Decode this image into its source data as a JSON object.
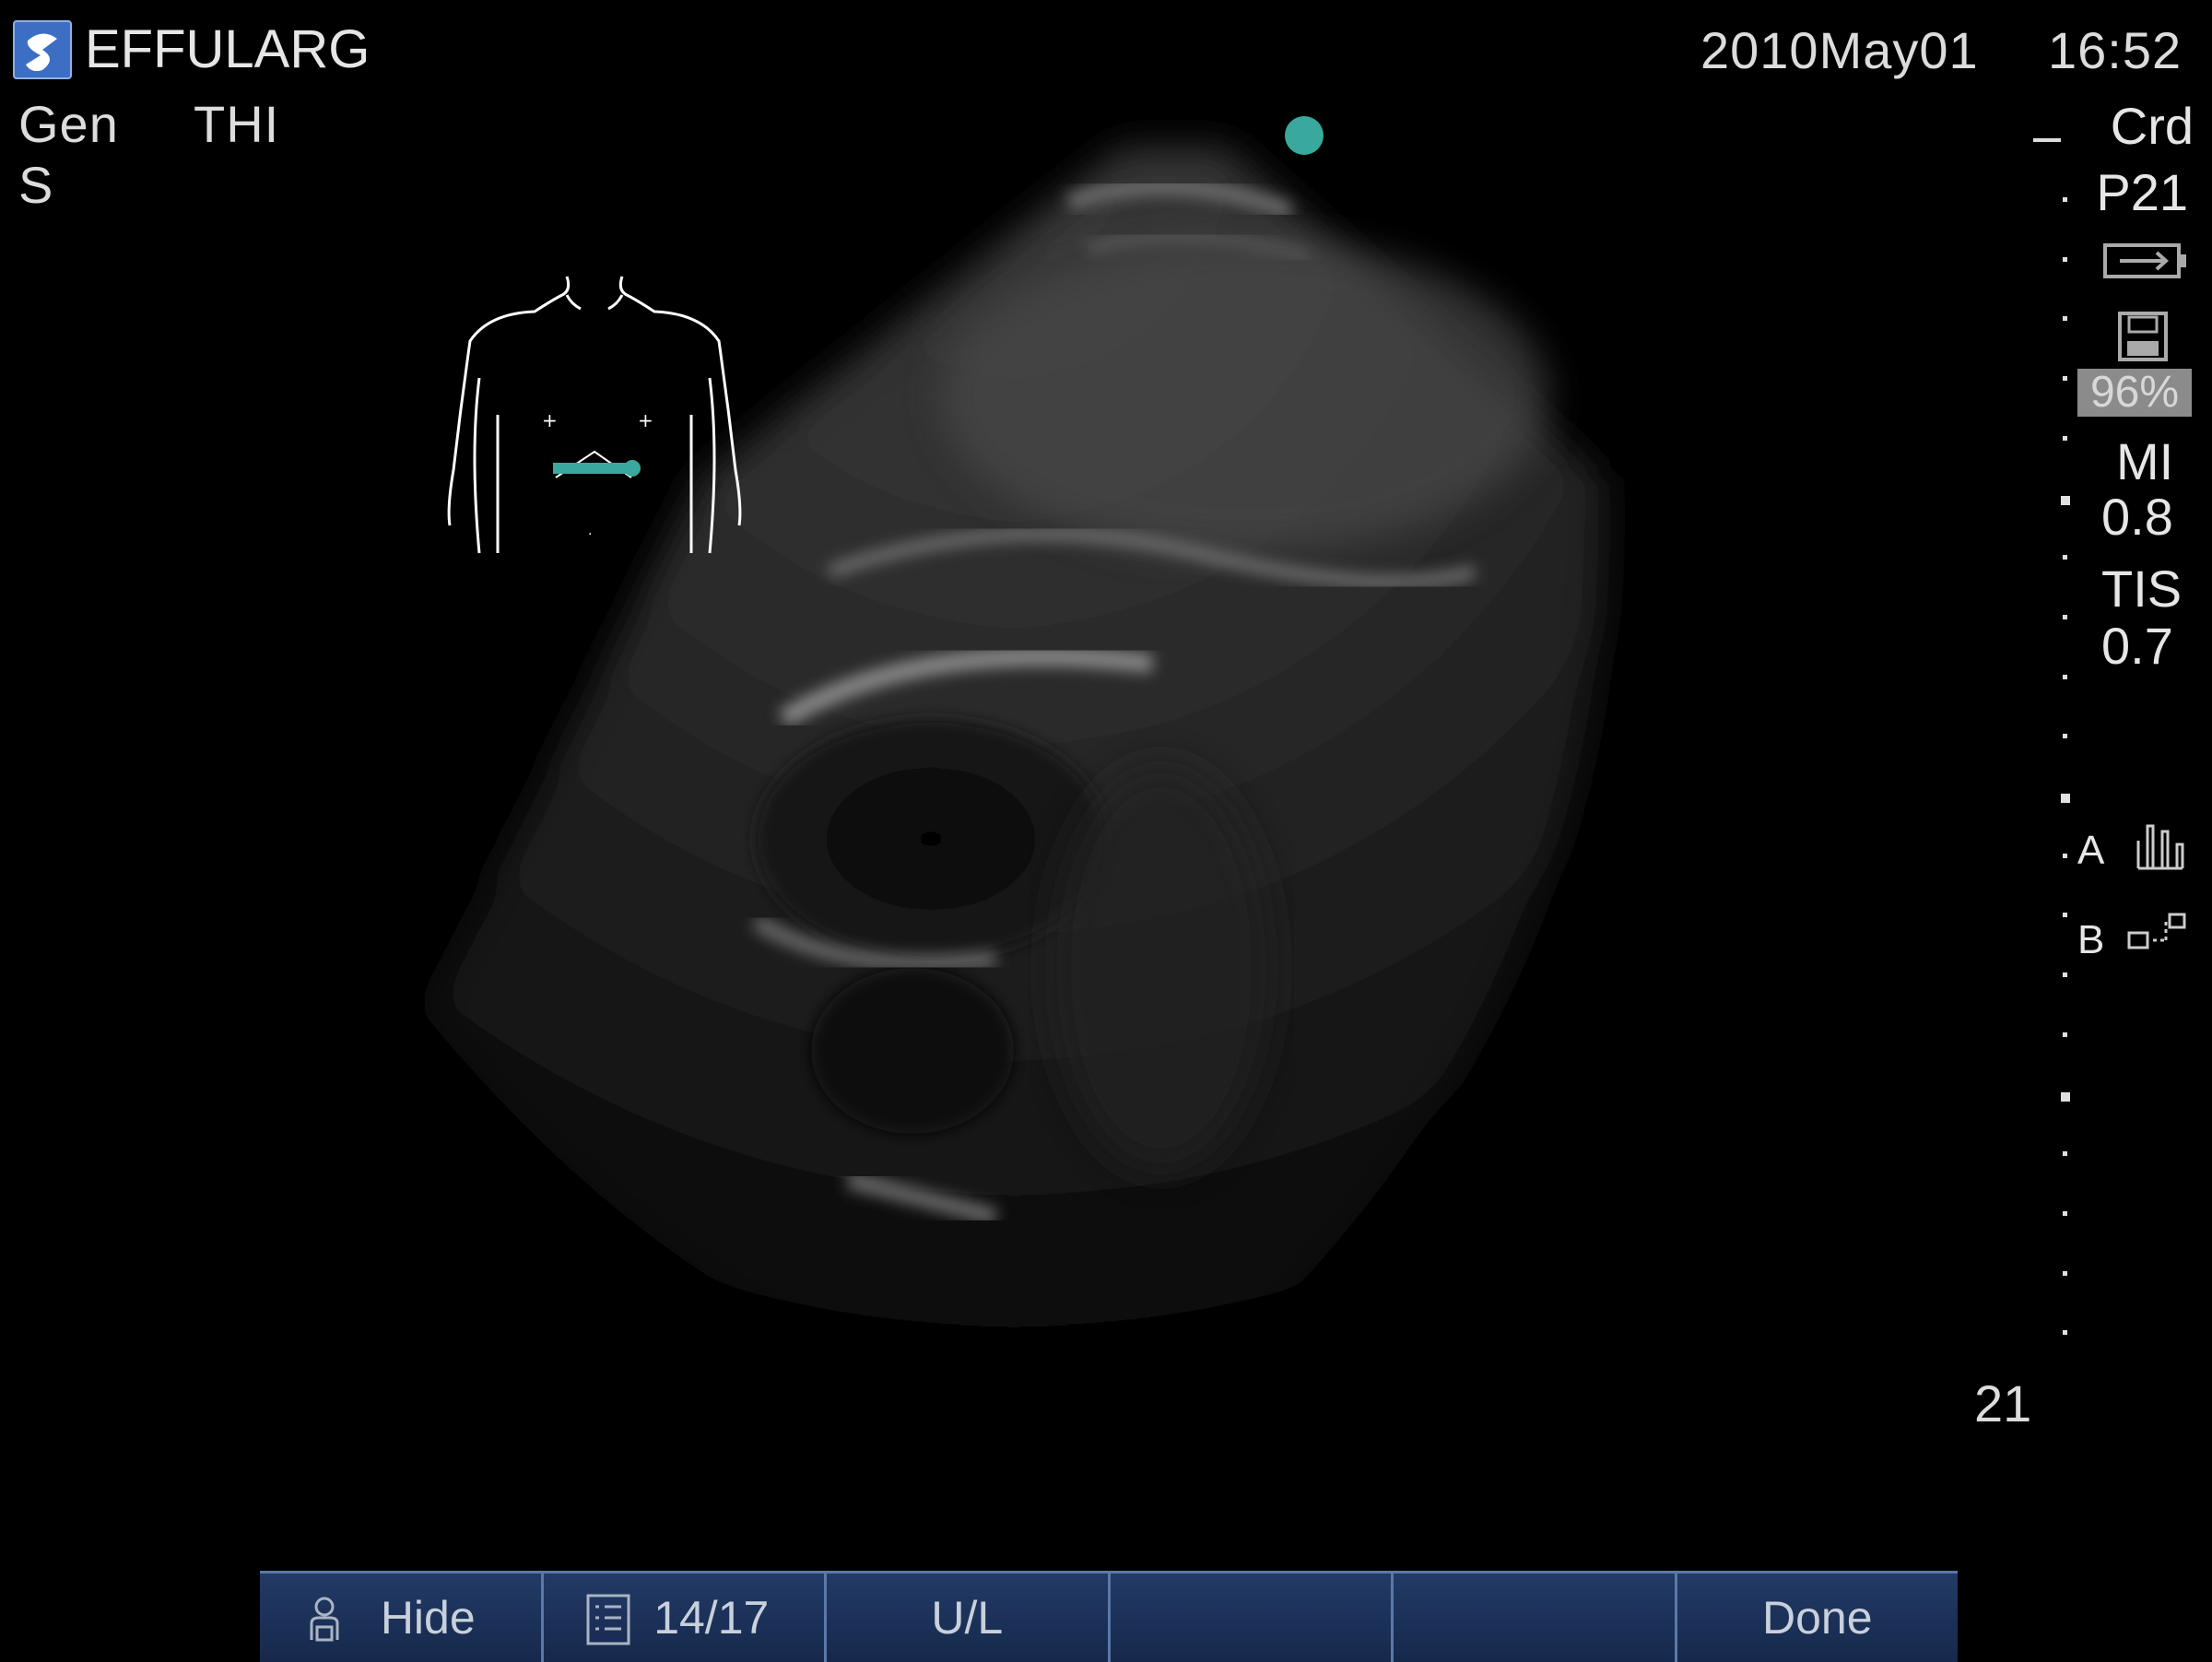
{
  "header": {
    "title": "EFFULARG",
    "date": "2010May01",
    "time": "16:52",
    "mode_gen": "Gen",
    "mode_thi": "THI",
    "mode_s": "S"
  },
  "right_panel": {
    "preset": "Crd",
    "probe": "P21",
    "storage_percent": "96%",
    "mi_label": "MI",
    "mi_value": "0.8",
    "tis_label": "TIS",
    "tis_value": "0.7",
    "focus_a": "A",
    "focus_b": "B"
  },
  "depth_label": "21",
  "softkeys": [
    {
      "label": "Hide",
      "icon": "patient-icon"
    },
    {
      "label": "14/17",
      "icon": "list-icon"
    },
    {
      "label": "U/L",
      "icon": ""
    },
    {
      "label": "",
      "icon": ""
    },
    {
      "label": "",
      "icon": ""
    },
    {
      "label": "Done",
      "icon": ""
    }
  ],
  "colors": {
    "marker_teal": "#3aa99d",
    "softkey_bar": "#1b3158",
    "background": "#000000"
  },
  "icons": [
    "logo-icon",
    "battery-icon",
    "save-disk-icon",
    "hand-icon",
    "probe-icon",
    "body-marker-icon"
  ]
}
